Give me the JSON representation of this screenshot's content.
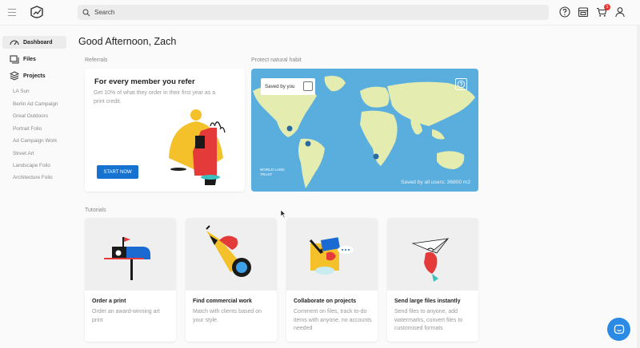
{
  "header": {
    "search_placeholder": "Search",
    "cart_count": "1",
    "icons": [
      "menu-icon",
      "logo-icon",
      "search-icon",
      "help-icon",
      "storefront-icon",
      "cart-icon",
      "user-icon"
    ]
  },
  "sidebar": {
    "main_items": [
      {
        "label": "Dashboard",
        "icon": "dashboard-icon",
        "active": true
      },
      {
        "label": "Files",
        "icon": "files-icon",
        "active": false
      },
      {
        "label": "Projects",
        "icon": "projects-icon",
        "active": false
      }
    ],
    "projects": [
      "LA Sun",
      "Berlin Ad Campaign",
      "Great Outdoors",
      "Portrait Folio",
      "Ad Campaign Work",
      "Street Art",
      "Landscape Folio",
      "Architecture Folio"
    ]
  },
  "main": {
    "greeting": "Good Afternoon, Zach",
    "referrals": {
      "section_label": "Referrals",
      "title": "For every member you refer",
      "description": "Get 10% of what they order in their first year as a print credit.",
      "button_label": "START NOW"
    },
    "protect": {
      "section_label": "Protect natural habit",
      "saved_by_you": "Saved by you",
      "saved_by_all": "Saved by all users: 36800 m2",
      "logo_text": "WORLD LAND TRUST"
    },
    "tutorials": {
      "section_label": "Tutorials",
      "cards": [
        {
          "title": "Order a print",
          "description": "Order an award-winning art print"
        },
        {
          "title": "Find commercial work",
          "description": "Match with clients based on your style."
        },
        {
          "title": "Collaborate on projects",
          "description": "Comment on files, track to-do items with anyone, no accounts needed"
        },
        {
          "title": "Send large files instantly",
          "description": "Send files to anyone, add watermarks, convert files to customised formats"
        }
      ]
    }
  },
  "colors": {
    "accent": "#1572d1",
    "map_ocean": "#5aaede",
    "map_land": "#e5ecb0",
    "badge": "#e53935",
    "chat": "#2a8ae4"
  }
}
